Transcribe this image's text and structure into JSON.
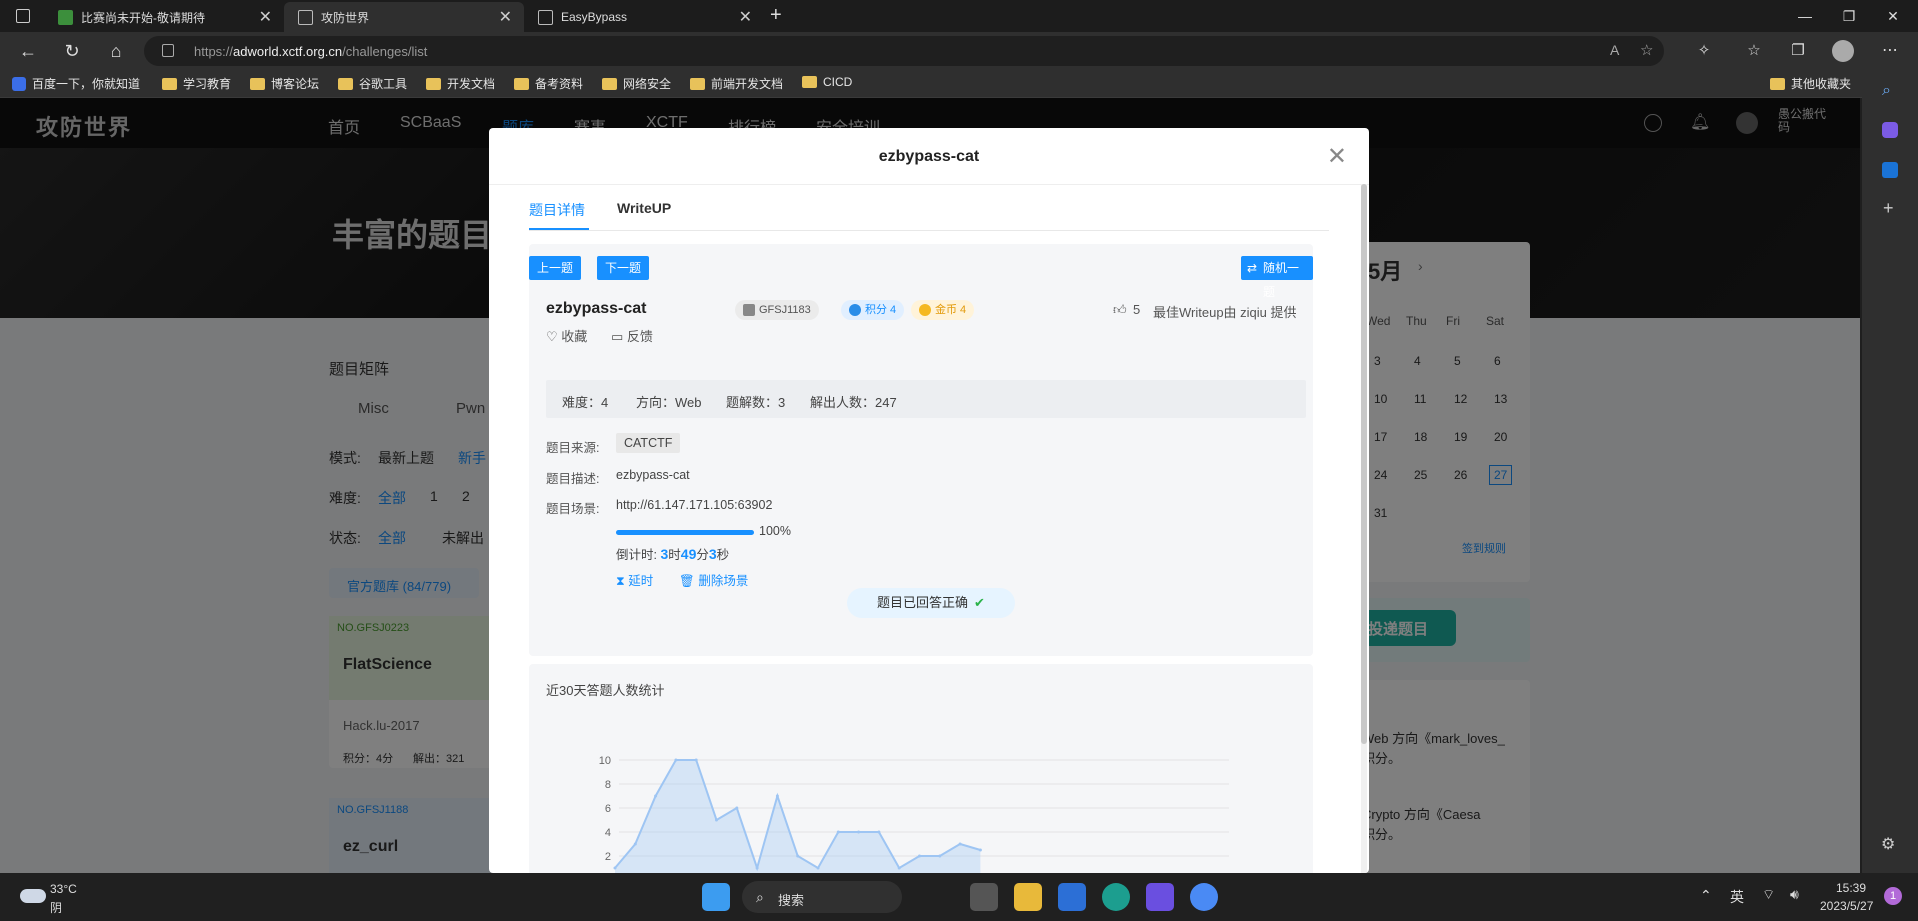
{
  "browser": {
    "tabs": [
      {
        "title": "比赛尚未开始-敬请期待",
        "active": false
      },
      {
        "title": "攻防世界",
        "active": true
      },
      {
        "title": "EasyBypass",
        "active": false
      }
    ],
    "url_prefix": "https://",
    "url_host": "adworld.xctf.org.cn",
    "url_path": "/challenges/list",
    "bookmarks": [
      "百度一下，你就知道",
      "学习教育",
      "博客论坛",
      "谷歌工具",
      "开发文档",
      "备考资料",
      "网络安全",
      "前端开发文档",
      "CICD"
    ],
    "other_bookmarks": "其他收藏夹"
  },
  "site": {
    "logo": "攻防世界",
    "nav": [
      "首页",
      "SCBaaS",
      "题库",
      "赛事",
      "XCTF",
      "排行榜",
      "安全培训"
    ],
    "user": "愚公搬代码",
    "hero_text": "丰富的题目",
    "section_title": "题目矩阵",
    "categories": [
      "Misc",
      "Pwn"
    ],
    "filter_mode_label": "模式:",
    "filter_mode_value": "最新上题",
    "filter_mode_value2": "新手",
    "difficulty_label": "难度:",
    "difficulty_all": "全部",
    "difficulty_1": "1",
    "difficulty_2": "2",
    "status_label": "状态:",
    "status_all": "全部",
    "status_unsolved": "未解出",
    "bank_tab": "官方题库 (84/779)",
    "card1_no": "NO.GFSJ0223",
    "card1_title": "FlatScience",
    "card1_source": "Hack.lu-2017",
    "card1_points": "积分：4分",
    "card1_solved": "解出：321",
    "card2_no": "NO.GFSJ1188",
    "card2_title": "ez_curl",
    "calendar": {
      "month": "5月",
      "days_header": [
        "Wed",
        "Thu",
        "Fri",
        "Sat"
      ],
      "rows": [
        [
          "3",
          "4",
          "5",
          "6"
        ],
        [
          "10",
          "11",
          "12",
          "13"
        ],
        [
          "17",
          "18",
          "19",
          "20"
        ],
        [
          "24",
          "25",
          "26",
          "27"
        ],
        [
          "31",
          "",
          "",
          ""
        ]
      ],
      "today": "27",
      "sign_rule": "签到规则"
    },
    "submit_banner": "投递题目",
    "news1_a": "Web 方向《mark_loves_",
    "news1_b": "积分。",
    "news2_a": "Crypto 方向《Caesa",
    "news2_b": "积分。"
  },
  "modal": {
    "title": "ezbypass-cat",
    "tabs": [
      "题目详情",
      "WriteUP"
    ],
    "prev_btn": "上一题",
    "next_btn": "下一题",
    "random_btn": "随机一题",
    "problem_title": "ezbypass-cat",
    "id_tag": "GFSJ1183",
    "points_tag": "积分 4",
    "coins_tag": "金币 4",
    "likes": "5",
    "best_writeup": "最佳Writeup由 ziqiu 提供",
    "favorite": "收藏",
    "feedback": "反馈",
    "stats": {
      "difficulty": "难度：4",
      "direction": "方向：Web",
      "writeups": "题解数：3",
      "solvers": "解出人数：247"
    },
    "source_label": "题目来源:",
    "source_value": "CATCTF",
    "desc_label": "题目描述:",
    "desc_value": "ezbypass-cat",
    "scene_label": "题目场景:",
    "scene_url": "http://61.147.171.105:63902",
    "progress": 1.0,
    "progress_text": "100%",
    "countdown_label": "倒计时:",
    "countdown_h": "3",
    "countdown_h_unit": "时",
    "countdown_m": "49",
    "countdown_m_unit": "分",
    "countdown_s": "3",
    "countdown_s_unit": "秒",
    "extend_btn": "延时",
    "delete_btn": "删除场景",
    "answered": "题目已回答正确"
  },
  "chart_data": {
    "type": "area",
    "title": "近30天答题人数统计",
    "yticks": [
      2,
      4,
      6,
      8,
      10
    ],
    "ylim": [
      0,
      10
    ],
    "values": [
      1,
      3,
      7,
      10,
      10,
      5,
      6,
      1,
      7,
      2,
      1,
      4,
      4,
      4,
      1,
      2,
      2,
      3,
      2.5
    ],
    "color": "#9ec5f3"
  },
  "taskbar": {
    "weather_temp": "33°C",
    "weather_desc": "阴",
    "search": "搜索",
    "ime": "英",
    "time": "15:39",
    "date": "2023/5/27",
    "notif": "1"
  }
}
